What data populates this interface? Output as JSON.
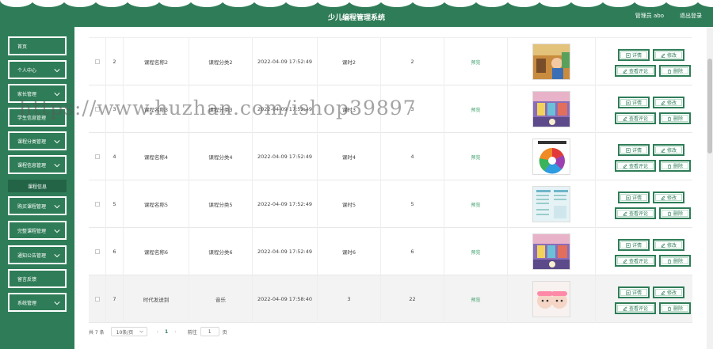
{
  "header": {
    "title": "少儿编程管理系统",
    "admin_label": "管理员 abo",
    "logout_label": "退出登录"
  },
  "sidebar": {
    "items": [
      {
        "label": "首页",
        "has_chevron": false
      },
      {
        "label": "个人中心",
        "has_chevron": true
      },
      {
        "label": "家长管理",
        "has_chevron": true
      },
      {
        "label": "学生信息管理",
        "has_chevron": false
      },
      {
        "label": "课程分类管理",
        "has_chevron": true
      },
      {
        "label": "课程信息管理",
        "has_chevron": true
      },
      {
        "label": "课程信息",
        "sub": true
      },
      {
        "label": "购买课程管理",
        "has_chevron": true
      },
      {
        "label": "完整课程管理",
        "has_chevron": true
      },
      {
        "label": "通知公告管理",
        "has_chevron": true
      },
      {
        "label": "留言反馈",
        "has_chevron": false
      },
      {
        "label": "系统管理",
        "has_chevron": true
      }
    ]
  },
  "table": {
    "rows": [
      {
        "index": "2",
        "name": "课程名称2",
        "category": "课程分类2",
        "time": "2022-04-09 17:52:49",
        "hours": "课时2",
        "count": "2",
        "preview": "预览",
        "thumb": "classroom"
      },
      {
        "index": "3",
        "name": "课程名称3",
        "category": "课程分类3",
        "time": "2022-04-09 17:52:49",
        "hours": "课时3",
        "count": "3",
        "preview": "预览",
        "thumb": "colorful-room"
      },
      {
        "index": "4",
        "name": "课程名称4",
        "category": "课程分类4",
        "time": "2022-04-09 17:52:49",
        "hours": "课时4",
        "count": "4",
        "preview": "预览",
        "thumb": "wheel-chart"
      },
      {
        "index": "5",
        "name": "课程名称5",
        "category": "课程分类5",
        "time": "2022-04-09 17:52:49",
        "hours": "课时5",
        "count": "5",
        "preview": "预览",
        "thumb": "document"
      },
      {
        "index": "6",
        "name": "课程名称6",
        "category": "课程分类6",
        "time": "2022-04-09 17:52:49",
        "hours": "课时6",
        "count": "6",
        "preview": "预览",
        "thumb": "colorful-room"
      },
      {
        "index": "7",
        "name": "时代发送到",
        "category": "音乐",
        "time": "2022-04-09 17:58:40",
        "hours": "3",
        "count": "22",
        "preview": "预览",
        "thumb": "babies"
      }
    ],
    "buttons": {
      "detail": "详情",
      "edit": "修改",
      "comments": "查看评论",
      "delete": "删除"
    }
  },
  "pagination": {
    "total": "共 7 条",
    "page_size": "10条/页",
    "prev": "‹",
    "current_page": "1",
    "next": "›",
    "goto_label": "前往",
    "goto_value": "1",
    "goto_unit": "页"
  },
  "watermark": "https://www.huzhan.com/ishop39897",
  "colors": {
    "primary": "#2f7d58",
    "preview_link": "#3a9d69"
  }
}
